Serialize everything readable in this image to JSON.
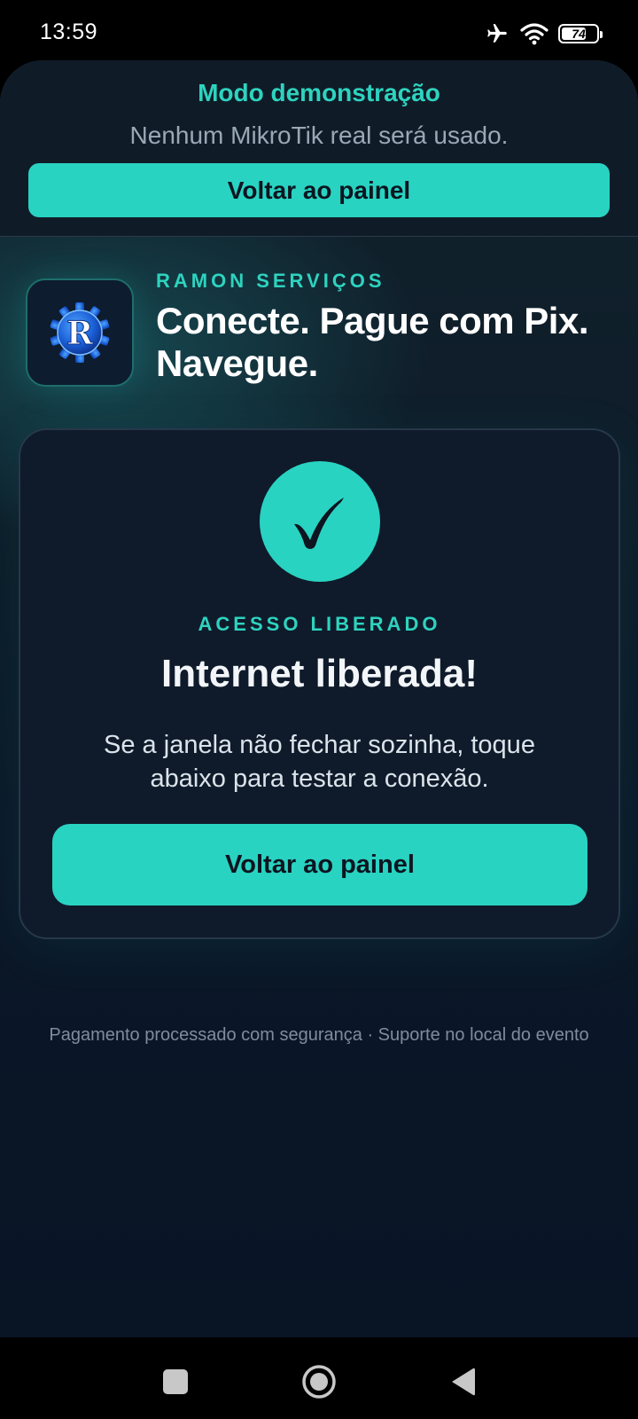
{
  "status_bar": {
    "time": "13:59",
    "icons": [
      "airplane-icon",
      "wifi-icon",
      "battery-icon"
    ],
    "battery_level": "74",
    "battery_fraction": 0.74
  },
  "demo_banner": {
    "title": "Modo demonstração",
    "subtitle": "Nenhum MikroTik real será usado.",
    "button_label": "Voltar ao painel"
  },
  "brand": {
    "logo_letter": "R",
    "name": "RAMON SERVIÇOS",
    "tagline": "Conecte. Pague com Pix. Navegue."
  },
  "card": {
    "icon": "checkmark-icon",
    "eyebrow": "ACESSO LIBERADO",
    "title": "Internet liberada!",
    "text": "Se a janela não fechar sozinha, toque abaixo para testar a conexão.",
    "button_label": "Voltar ao painel"
  },
  "footer": {
    "note": "Pagamento processado com segurança · Suporte no local do evento"
  },
  "nav_bar": {
    "buttons": [
      "recents-square-icon",
      "home-circle-icon",
      "back-triangle-icon"
    ]
  },
  "colors": {
    "accent": "#29d3c1",
    "accent_text": "#2ed3bf",
    "background": "#0b1828",
    "card": "#0f1b2b",
    "muted_text": "#9aa8b6"
  }
}
